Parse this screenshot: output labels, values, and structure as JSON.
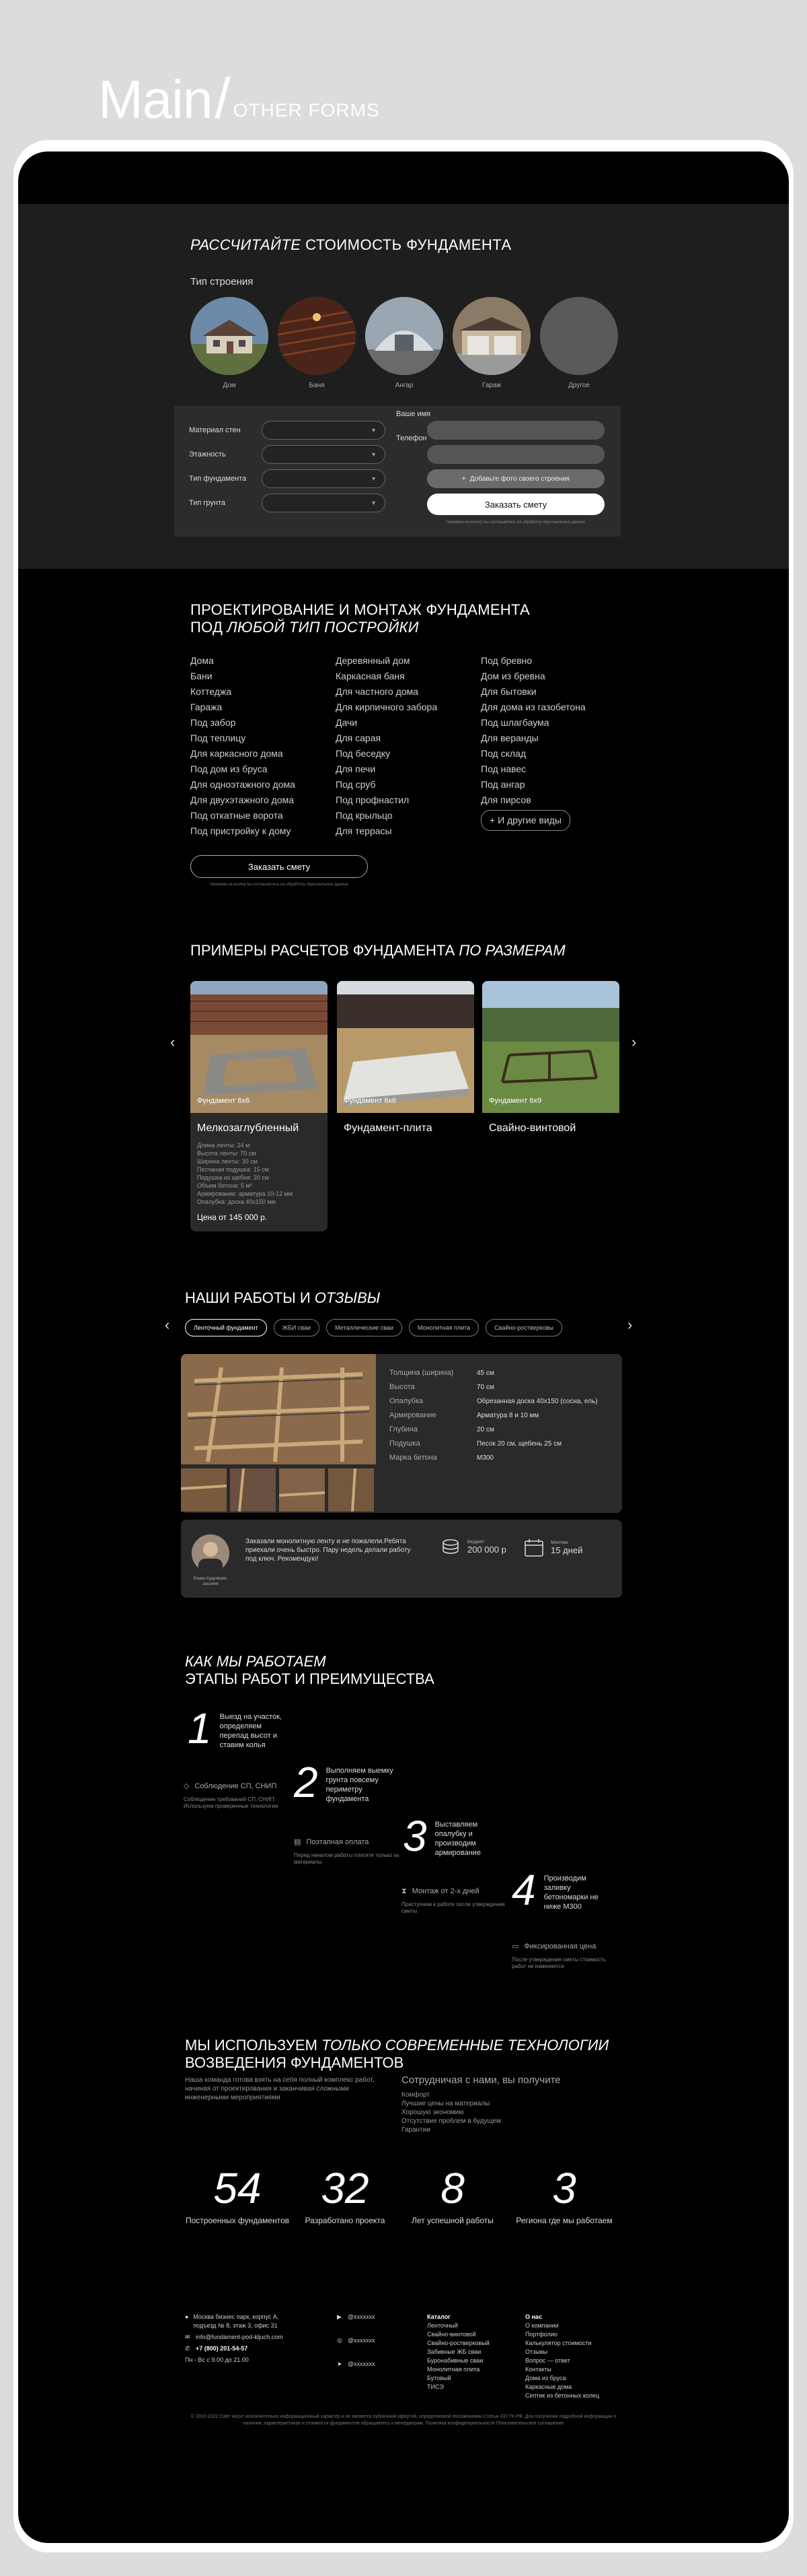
{
  "heading": {
    "main": "Main",
    "slash": "/",
    "other": "OTHER FORMS"
  },
  "calculator": {
    "title_italic": "РАССЧИТАЙТЕ",
    "title_rest": " СТОИМОСТЬ ФУНДАМЕНТА",
    "type_label": "Тип строения",
    "types": [
      "Дом",
      "Баня",
      "Ангар",
      "Гараж",
      "Другое"
    ],
    "fields_left": [
      "Материал стен",
      "Этажность",
      "Тип фундамента",
      "Тип грунта"
    ],
    "fields_right": [
      "Ваше имя",
      "Телефон"
    ],
    "photo_button": "Добавьте фото своего строения",
    "order_button": "Заказать смету",
    "note": "Нажимая на кнопку вы соглашаетесь на обработку персональных данных"
  },
  "design": {
    "title_line1": "ПРОЕКТИРОВАНИЕ И МОНТАЖ ФУНДАМЕНТА",
    "title_line2_pre": "ПОД ",
    "title_line2_italic": "ЛЮБОЙ ТИП ПОСТРОЙКИ",
    "col1": [
      "Дома",
      "Бани",
      "Коттеджа",
      "Гаража",
      "Под забор",
      "Под теплицу",
      "Для каркасного дома",
      "Под дом из бруса",
      "Для одноэтажного дома",
      "Для двухэтажного дома",
      "Под откатные ворота",
      "Под пристройку к дому"
    ],
    "col2": [
      "Деревянный дом",
      "Каркасная баня",
      "Для частного дома",
      "Для кирпичного забора",
      "Дачи",
      "Для сарая",
      "Под беседку",
      "Для печи",
      "Под сруб",
      "Под профнастил",
      "Под крыльцо",
      "Для террасы"
    ],
    "col3": [
      "Под бревно",
      "Дом из бревна",
      "Для бытовки",
      "Для дома из газобетона",
      "Под шлагбаума",
      "Для веранды",
      "Под склад",
      "Под навес",
      "Под ангар",
      "Для пирсов"
    ],
    "more": "+ И другие виды",
    "order_button": "Заказать смету",
    "note": "Нажимая на кнопку вы соглашаетесь на обработку персональных данных"
  },
  "examples": {
    "title_pre": "ПРИМЕРЫ РАСЧЕТОВ ФУНДАМЕНТА ",
    "title_italic": "ПО РАЗМЕРАМ",
    "cards": [
      {
        "tag": "Фундамент 6x6",
        "name": "Мелкозаглубленный",
        "specs": [
          "Длина ленты: 24 м",
          "Высота ленты: 70 см",
          "Ширина ленты: 30 см",
          "Песчаная подушка: 15 см",
          "Подушка из щебня: 20 см",
          "Объем бетона: 5 м³",
          "Армирование: арматура 10-12 мм",
          "Опалубка: доска 40х150 мм"
        ],
        "price": "Цена от 145 000 р."
      },
      {
        "tag": "Фундамент 6x6",
        "name": "Фундамент-плита"
      },
      {
        "tag": "Фундамент 6x9",
        "name": "Свайно-винтовой"
      }
    ]
  },
  "works": {
    "title_pre": "НАШИ РАБОТЫ И ",
    "title_italic": "ОТЗЫВЫ",
    "tabs": [
      "Ленточный фундамент",
      "ЖБИ сваи",
      "Металлические сваи",
      "Монолитная плита",
      "Свайно-ростверковы"
    ],
    "params": [
      {
        "k": "Толщина (ширина)",
        "v": "45 см"
      },
      {
        "k": "Высота",
        "v": "70 см"
      },
      {
        "k": "Опалубка",
        "v": "Обрезанная доска 40х150 (сосна, ель)"
      },
      {
        "k": "Армирование",
        "v": "Арматура 8 и 10 мм"
      },
      {
        "k": "Глубина",
        "v": "20 см"
      },
      {
        "k": "Подушка",
        "v": "Песок 20 см, щебень 25 см"
      },
      {
        "k": "Марка бетона",
        "v": "M300"
      }
    ],
    "review": {
      "text": "Заказали монолитную ленту и не пожалели.Ребята приехали очень быстро. Пару недель делали работу под ключ. Рекомендую!",
      "author": "Роман Кудрявцев, заказчик",
      "budget_label": "Бюджет",
      "budget": "200 000 р",
      "term_label": "Монтаж",
      "term": "15 дней"
    }
  },
  "steps": {
    "title_italic": "КАК МЫ РАБОТАЕМ",
    "title_line2": "ЭТАПЫ РАБОТ И ПРЕИМУЩЕСТВА",
    "items": [
      {
        "n": "1",
        "text": "Выезд на участок, определяем перепад высот и ставим колья"
      },
      {
        "n": "2",
        "text": "Выполняем выемку грунта повсему периметру фундамента"
      },
      {
        "n": "3",
        "text": "Выставляем опалубку и производим армирование"
      },
      {
        "n": "4",
        "text": "Производим заливку бетономарки не ниже М300"
      }
    ],
    "advantages": [
      {
        "title": "Соблюдение СП, СНИП",
        "desc": "Соблюдение требований СП, СНИП. Используем проверенные технологии"
      },
      {
        "title": "Поэтапная оплата",
        "desc": "Перед началом работы платите только за материалы"
      },
      {
        "title": "Монтаж от 2-х дней",
        "desc": "Приступаем к работе после утверждения сметы"
      },
      {
        "title": "Фиксированная цена",
        "desc": "После утверждения сметы стоимость работ не изменяется"
      }
    ]
  },
  "tech": {
    "title_pre": "МЫ ИСПОЛЬЗУЕМ ",
    "title_italic": "ТОЛЬКО СОВРЕМЕННЫЕ ТЕХНОЛОГИИ",
    "title_line2": "ВОЗВЕДЕНИЯ ФУНДАМЕНТОВ",
    "desc": "Наша команда готова взять на себя полный комплекс работ, начиная от проектирования и заканчивая сложными инженерными мероприятиями",
    "coop_title": "Сотрудничая с нами, вы получите",
    "coop_items": [
      "Комфорт",
      "Лучшие цены на материалы",
      "Хорошую экономию",
      "Отсутствие проблем в будущем",
      "Гарантии"
    ],
    "counters": [
      {
        "n": "54",
        "l": "Построенных фундаментов"
      },
      {
        "n": "32",
        "l": "Разработано проекта"
      },
      {
        "n": "8",
        "l": "Лет успешной работы"
      },
      {
        "n": "3",
        "l": "Региона где мы работаем"
      }
    ]
  },
  "footer": {
    "address": "Москва бизнес парк, корпус А, подъезд № 8, этаж 3, офис 31",
    "email": "info@fundament-pod-kljuch.com",
    "phone": "+7 (800) 201-54-57",
    "hours": "Пн - Вс с 9.00 до 21.00",
    "socials": [
      "@ххххххх",
      "@ххххххх",
      "@ххххххх"
    ],
    "catalog_title": "Каталог",
    "catalog": [
      "Ленточный",
      "Свайно-винтовой",
      "Свайно-ростверковый",
      "Забивные ЖБ сваи",
      "Буронабивные сваи",
      "Монолитная плита",
      "Бутовый",
      "ТИСЭ"
    ],
    "about_title": "О нас",
    "about": [
      "О компании",
      "Портфолио",
      "Калькулятор стоимости",
      "Отзывы",
      "Вопрос — ответ",
      "Контакты",
      "Дома из бруса",
      "Каркасные дома",
      "Септик из бетонных колец"
    ],
    "copyright": "© 2010-2022 Сайт носит исключительно информационный характер и не является публичной офертой, определяемой положениями Статьи 437 ГК РФ. Для получения подробной информации о наличии, характеристиках и стоимости фундаментов обращайтесь к менеджерам. Политика конфиденциальности Пользовательское соглашение"
  },
  "colors": {
    "background": "#dcdcdc",
    "screen": "#000000",
    "panel": "#1e1e1e",
    "card": "#2a2a2a"
  }
}
